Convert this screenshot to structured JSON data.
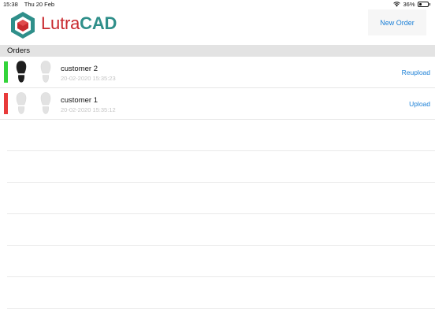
{
  "status_bar": {
    "time": "15:38",
    "date": "Thu 20 Feb",
    "battery": "36%",
    "battery_level": 0.36
  },
  "header": {
    "logo_text_light": "Lutra",
    "logo_text_bold": "CAD",
    "new_order_label": "New Order",
    "colors": {
      "logo_red": "#c8282d",
      "logo_teal": "#2f8f8a",
      "accent": "#1a7fd6"
    }
  },
  "orders_section": {
    "title": "Orders"
  },
  "orders": [
    {
      "name": "customer 2",
      "date": "20-02-2020 15:35:23",
      "action": "Reupload",
      "status_color": "#33d43a",
      "left_scanned": true,
      "right_scanned": false
    },
    {
      "name": "customer 1",
      "date": "20-02-2020 15:35:12",
      "action": "Upload",
      "status_color": "#e83a3a",
      "left_scanned": false,
      "right_scanned": false
    }
  ]
}
